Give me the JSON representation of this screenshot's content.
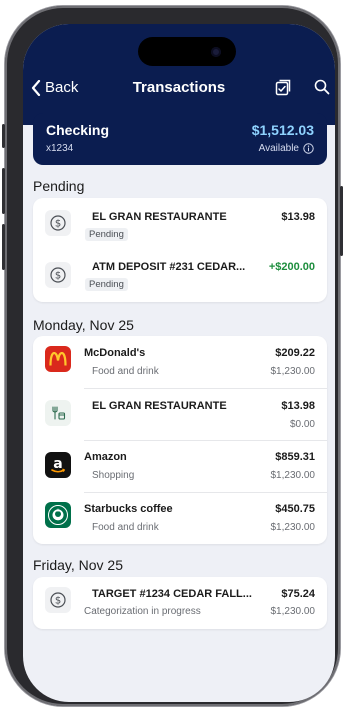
{
  "nav": {
    "back_label": "Back",
    "title": "Transactions"
  },
  "account": {
    "name": "Checking",
    "number": "x1234",
    "balance": "$1,512.03",
    "available_label": "Available"
  },
  "sections": {
    "pending": "Pending",
    "monday": "Monday, Nov 25",
    "friday": "Friday, Nov 25"
  },
  "pending": [
    {
      "name": "EL GRAN RESTAURANTE",
      "amount": "$13.98",
      "status": "Pending",
      "icon": "dollar-circle-icon"
    },
    {
      "name": "ATM DEPOSIT #231 CEDAR...",
      "amount": "+$200.00",
      "status": "Pending",
      "icon": "dollar-circle-icon"
    }
  ],
  "monday": [
    {
      "name": "McDonald's",
      "category": "Food and drink",
      "amount": "$209.22",
      "balance": "$1,230.00",
      "icon": "mcdonalds-logo"
    },
    {
      "name": "EL GRAN RESTAURANTE",
      "category": "",
      "amount": "$13.98",
      "balance": "$0.00",
      "icon": "food-drink-icon"
    },
    {
      "name": "Amazon",
      "category": "Shopping",
      "amount": "$859.31",
      "balance": "$1,230.00",
      "icon": "amazon-logo"
    },
    {
      "name": "Starbucks coffee",
      "category": "Food and drink",
      "amount": "$450.75",
      "balance": "$1,230.00",
      "icon": "starbucks-logo"
    }
  ],
  "friday": [
    {
      "name": "TARGET #1234 CEDAR FALL...",
      "category": "Categorization in progress",
      "amount": "$75.24",
      "balance": "$1,230.00",
      "icon": "dollar-circle-icon"
    }
  ],
  "colors": {
    "header": "#0b1d50",
    "balance": "#8fd3ff",
    "positive": "#1e8e3e",
    "mcdonalds": "#da291c",
    "starbucks": "#00704a"
  }
}
